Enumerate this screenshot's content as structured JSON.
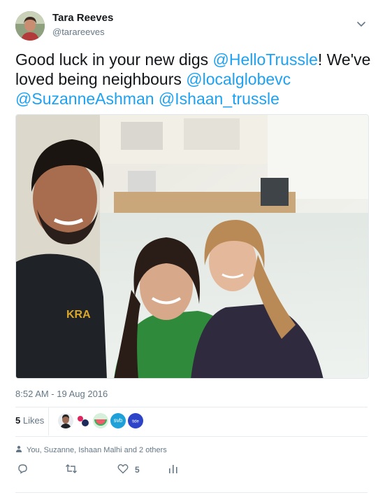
{
  "author": {
    "name": "Tara Reeves",
    "handle": "@tarareeves"
  },
  "tweet": {
    "segments": [
      {
        "text": "Good luck in your new digs ",
        "mention": false
      },
      {
        "text": "@HelloTrussle",
        "mention": true
      },
      {
        "text": "! We've loved being neighbours ",
        "mention": false
      },
      {
        "text": "@localglobevc",
        "mention": true
      },
      {
        "text": " ",
        "mention": false
      },
      {
        "text": "@SuzanneAshman",
        "mention": true
      },
      {
        "text": " ",
        "mention": false
      },
      {
        "text": "@Ishaan_trussle",
        "mention": true
      }
    ],
    "timestamp": "8:52 AM - 19 Aug 2016"
  },
  "stats": {
    "likes_count": "5",
    "likes_label": "Likes"
  },
  "likers": [
    {
      "name": "liker-avatar-person"
    },
    {
      "name": "liker-avatar-dots"
    },
    {
      "name": "liker-avatar-watermelon"
    },
    {
      "name": "liker-avatar-svb",
      "label": "svb"
    },
    {
      "name": "liker-avatar-tide",
      "label": "tide"
    }
  ],
  "reply_context": {
    "text": "You, Suzanne, Ishaan Malhi and 2 others"
  },
  "actions": {
    "reply_count": "",
    "retweet_count": "",
    "like_count": "5",
    "analytics_count": ""
  },
  "colors": {
    "accent": "#1da1f2",
    "muted": "#657786",
    "text": "#14171a",
    "divider": "#e6ecf0"
  }
}
